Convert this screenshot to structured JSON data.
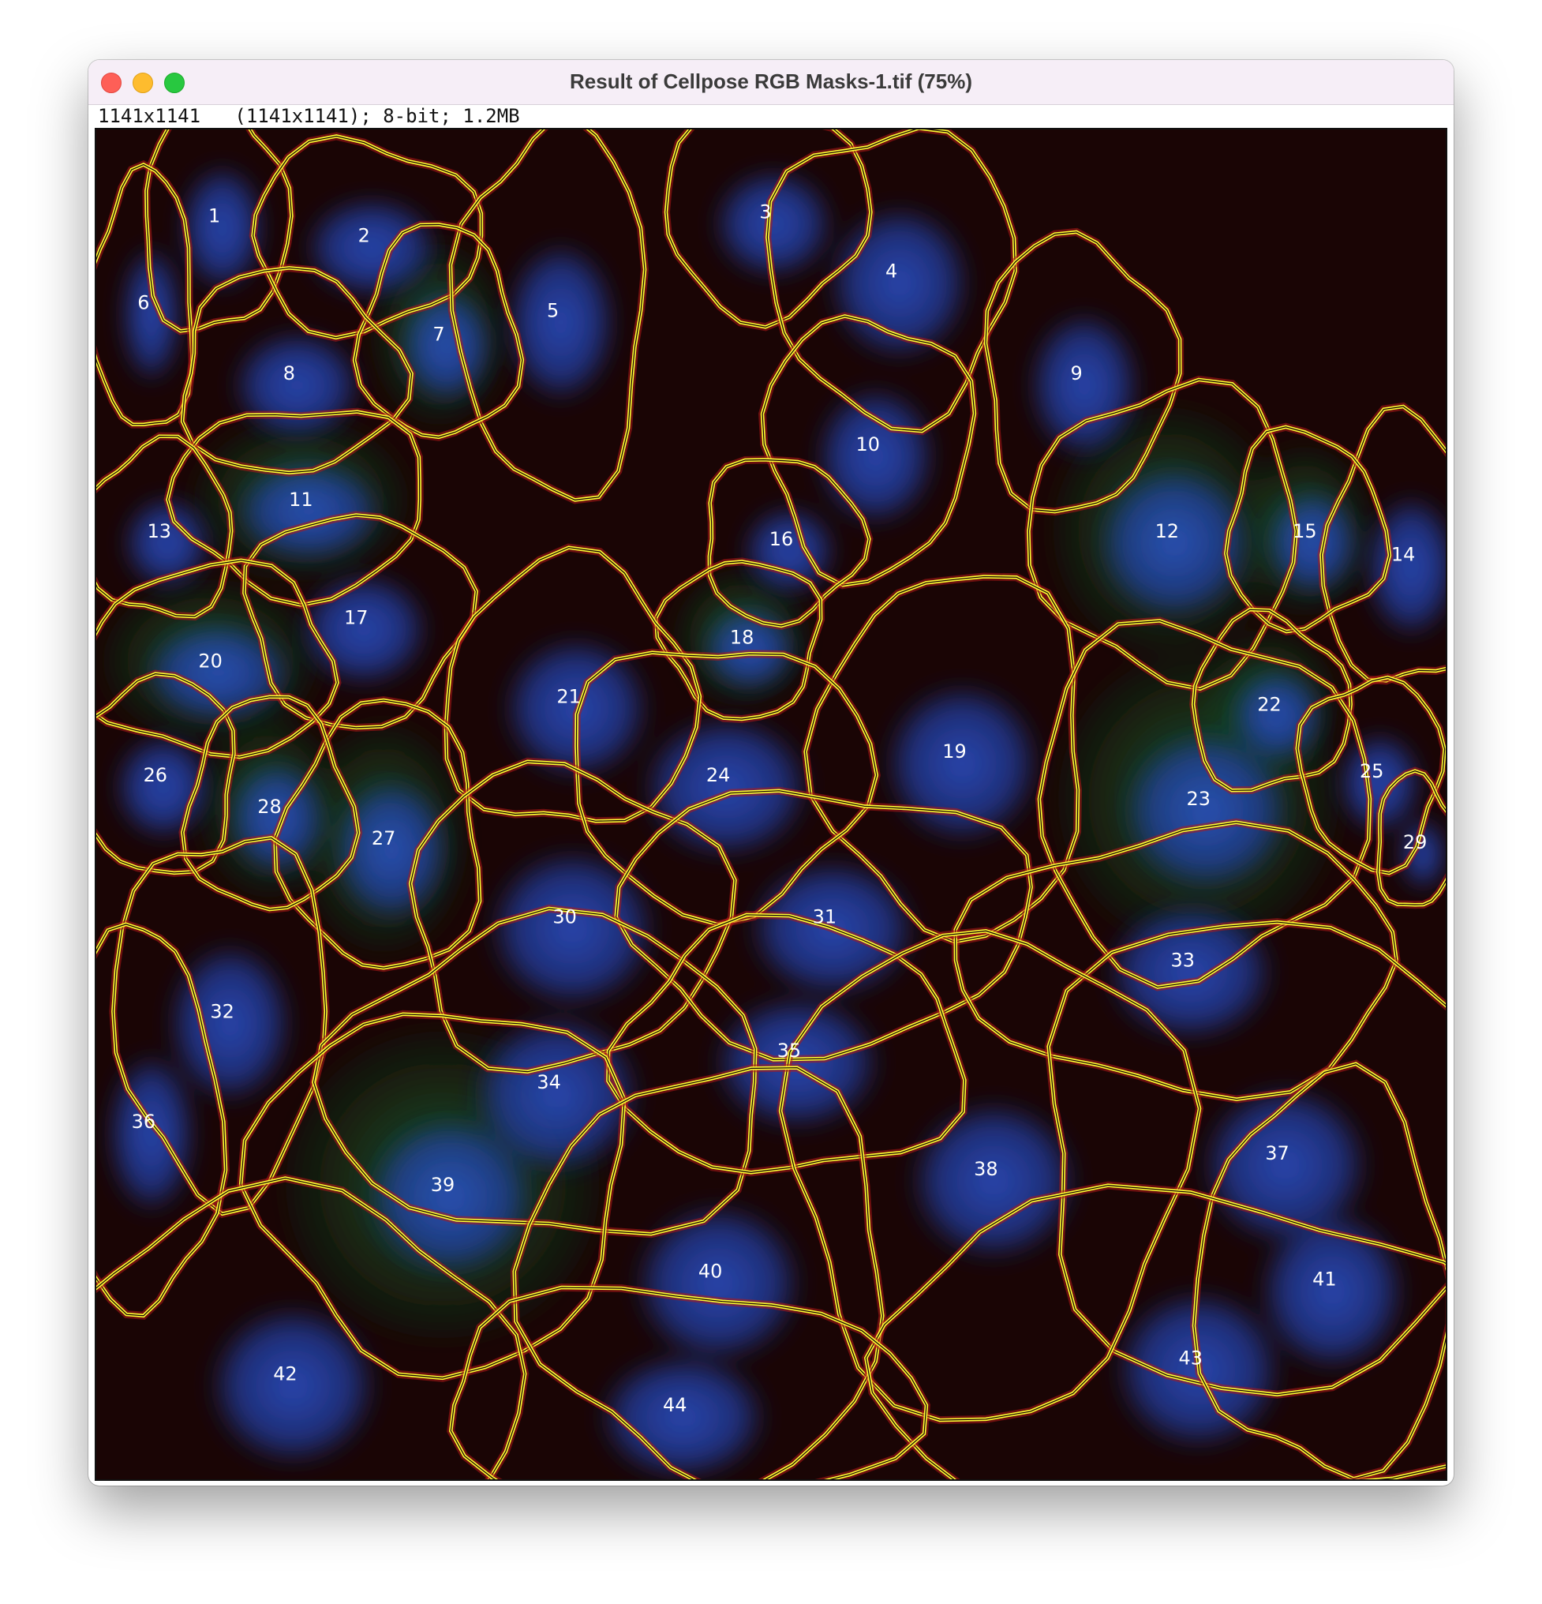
{
  "window": {
    "title": "Result of Cellpose RGB Masks-1.tif (75%)",
    "info": "1141x1141   (1141x1141); 8-bit; 1.2MB",
    "controls": [
      "close",
      "minimize",
      "zoom"
    ]
  },
  "image": {
    "outline_color": "#ffff33",
    "channel_colors": {
      "membrane": "#c81e1e",
      "cytoplasm": "#1e8c3c",
      "nucleus": "#2846b4"
    },
    "cell_labels": [
      "1",
      "2",
      "3",
      "4",
      "5",
      "6",
      "7",
      "8",
      "9",
      "10",
      "11",
      "12",
      "13",
      "14",
      "15",
      "16",
      "17",
      "18",
      "19",
      "20",
      "21",
      "22",
      "23",
      "24",
      "25",
      "26",
      "27",
      "28",
      "29",
      "30",
      "31",
      "32",
      "33",
      "34",
      "35",
      "36",
      "37",
      "38",
      "39",
      "40",
      "41",
      "42",
      "43",
      "44"
    ]
  }
}
